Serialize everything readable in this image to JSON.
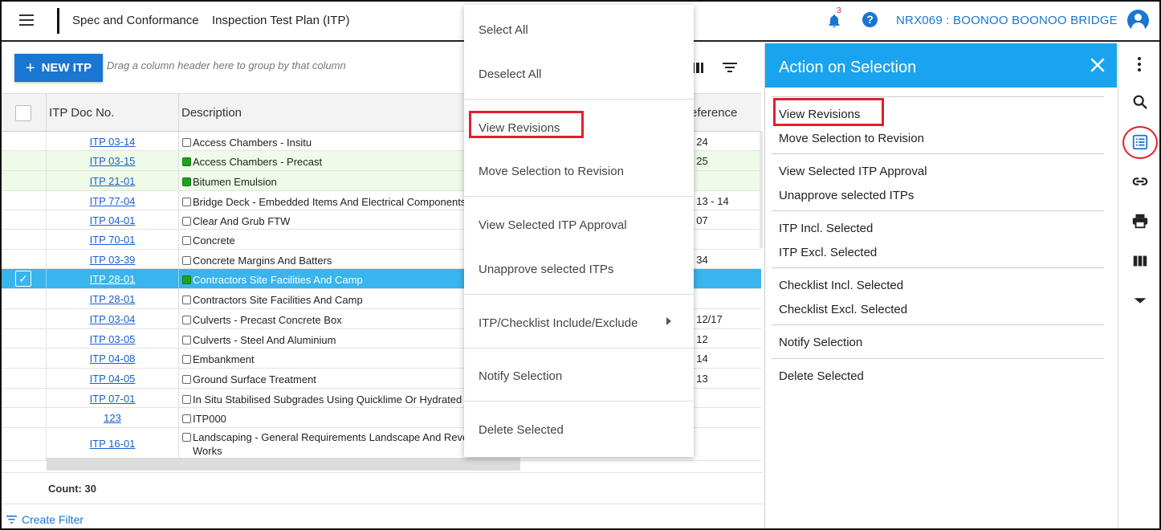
{
  "header": {
    "breadcrumb_module": "Spec and Conformance",
    "breadcrumb_page": "Inspection Test Plan (ITP)",
    "notification_count": "3",
    "help_glyph": "?",
    "project": "NRX069 : BOONOO BOONOO BRIDGE"
  },
  "toolbar": {
    "new_button": "NEW ITP",
    "new_plus": "+",
    "group_hint": "Drag a column header here to group by that column"
  },
  "grid": {
    "columns": [
      "ITP Doc No.",
      "Description",
      "eference"
    ],
    "rows": [
      {
        "doc": "ITP 03-14",
        "desc": "Access Chambers - Insitu",
        "ref": "I 24",
        "dot": false,
        "style": "plain"
      },
      {
        "doc": "ITP 03-15",
        "desc": "Access Chambers - Precast",
        "ref": "I 25",
        "dot": true,
        "style": "green"
      },
      {
        "doc": "ITP 21-01",
        "desc": "Bitumen Emulsion",
        "ref": "",
        "dot": true,
        "style": "green"
      },
      {
        "doc": "ITP 77-04",
        "desc": "Bridge Deck - Embedded Items And Electrical Components",
        "ref": "I 13 - 14",
        "dot": false,
        "style": "plain"
      },
      {
        "doc": "ITP 04-01",
        "desc": "Clear And Grub FTW",
        "ref": "I 07",
        "dot": false,
        "style": "plain"
      },
      {
        "doc": "ITP 70-01",
        "desc": "Concrete",
        "ref": "",
        "dot": false,
        "style": "plain"
      },
      {
        "doc": "ITP 03-39",
        "desc": "Concrete Margins And Batters",
        "ref": "I 34",
        "dot": false,
        "style": "plain"
      },
      {
        "doc": "ITP 28-01",
        "desc": "Contractors Site Facilities And Camp",
        "ref": "",
        "dot": true,
        "style": "sel"
      },
      {
        "doc": "ITP 28-01",
        "desc": "Contractors Site Facilities And Camp",
        "ref": "",
        "dot": false,
        "style": "plain"
      },
      {
        "doc": "ITP 03-04",
        "desc": "Culverts - Precast Concrete Box",
        "ref": "I 12/17",
        "dot": false,
        "style": "plain"
      },
      {
        "doc": "ITP 03-05",
        "desc": "Culverts - Steel And Aluminium",
        "ref": "I 12",
        "dot": false,
        "style": "plain"
      },
      {
        "doc": "ITP 04-08",
        "desc": "Embankment",
        "ref": "I 14",
        "dot": false,
        "style": "plain"
      },
      {
        "doc": "ITP 04-05",
        "desc": "Ground Surface Treatment",
        "ref": "I 13",
        "dot": false,
        "style": "plain"
      },
      {
        "doc": "ITP 07-01",
        "desc": "In Situ Stabilised Subgrades Using Quicklime Or Hydrated",
        "ref": "",
        "dot": false,
        "style": "plain"
      },
      {
        "doc": "123",
        "desc": "ITP000",
        "ref": "",
        "dot": false,
        "style": "plain"
      },
      {
        "doc": "ITP 16-01",
        "desc": "Landscaping - General Requirements Landscape And Reve",
        "desc2": "Works",
        "ref": "",
        "dot": false,
        "style": "plain"
      }
    ],
    "count_label": "Count: 30",
    "create_filter": "Create Filter"
  },
  "context_menu": {
    "items": [
      "Select All",
      "Deselect All",
      "View Revisions",
      "Move Selection to Revision",
      "View Selected ITP Approval",
      "Unapprove selected ITPs",
      "ITP/Checklist Include/Exclude",
      "Notify Selection",
      "Delete Selected"
    ]
  },
  "panel": {
    "title": "Action on Selection",
    "items": [
      "View Revisions",
      "Move Selection to Revision",
      "View Selected ITP Approval",
      "Unapprove selected ITPs",
      "ITP Incl. Selected",
      "ITP Excl. Selected",
      "Checklist Incl. Selected",
      "Checklist Excl. Selected",
      "Notify Selection",
      "Delete Selected"
    ]
  },
  "rail": {
    "icons": [
      "more-vert-icon",
      "search-icon",
      "list-view-icon",
      "link-icon",
      "print-icon",
      "columns-icon",
      "dropdown-arrow-icon"
    ]
  },
  "colors": {
    "accent": "#1976d2",
    "panel_header": "#1aa3ef",
    "selected_row": "#39b4ec",
    "green_row": "#eefbe8",
    "status_dot": "#1da31d",
    "highlight": "#e0202a"
  }
}
